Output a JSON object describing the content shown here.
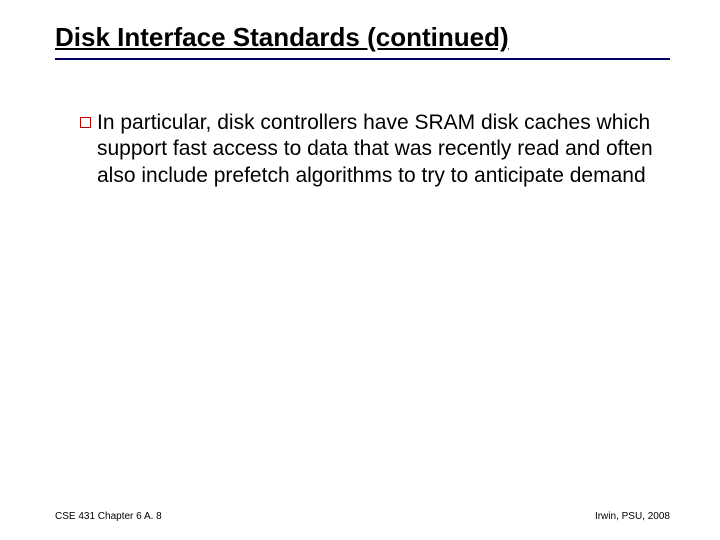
{
  "slide": {
    "title": "Disk Interface Standards (continued)",
    "bullets": [
      "In particular, disk controllers have SRAM disk caches which support fast access to data that was recently read and often also include prefetch algorithms to try to anticipate demand"
    ]
  },
  "footer": {
    "left": "CSE 431  Chapter 6 A. 8",
    "right": "Irwin, PSU, 2008"
  }
}
